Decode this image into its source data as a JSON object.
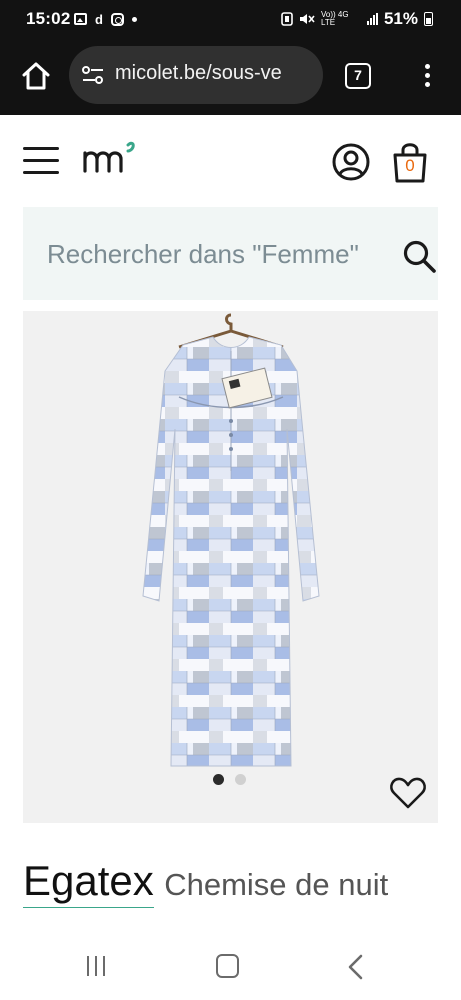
{
  "status_bar": {
    "time": "15:02",
    "notif_d": "d",
    "network": "Vo)) 4G LTE",
    "battery": "51%"
  },
  "browser": {
    "url": "micolet.be/sous-ve",
    "tab_count": "7"
  },
  "search": {
    "placeholder": "Rechercher dans \"Femme\""
  },
  "cart": {
    "count": "0"
  },
  "gallery": {
    "image_count": 2,
    "active_index": 0
  },
  "product": {
    "brand": "Egatex",
    "name": "Chemise de nuit"
  },
  "colors": {
    "accent": "#e9690f",
    "logo_dot": "#3aa68a",
    "search_bg": "#f1f6f5"
  }
}
